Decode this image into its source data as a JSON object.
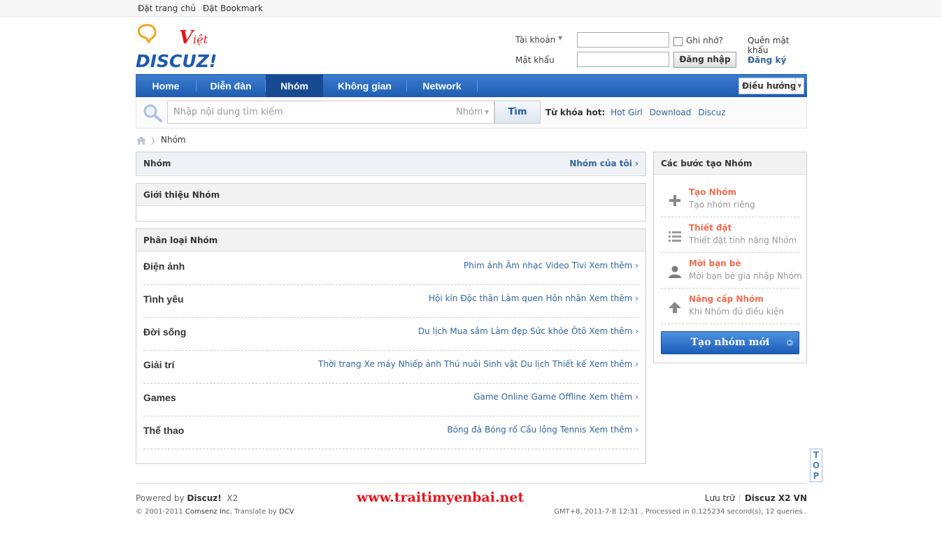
{
  "topbar": {
    "set_home": "Đặt trang chủ",
    "bookmark": "Đặt Bookmark"
  },
  "logo": {
    "script": "Việt",
    "brand": "DISCUZ!"
  },
  "login": {
    "account_label": "Tài khoản",
    "password_label": "Mật khẩu",
    "remember_label": "Ghi nhớ?",
    "forgot_link": "Quên mật khẩu",
    "login_button": "Đăng nhập",
    "register_link": "Đăng ký"
  },
  "nav": {
    "items": [
      "Home",
      "Diễn đàn",
      "Nhóm",
      "Không gian",
      "Network"
    ],
    "active_index": 2,
    "quick_nav": "Điều hướng"
  },
  "search": {
    "placeholder": "Nhập nội dung tìm kiếm",
    "scope": "Nhóm",
    "button": "Tìm",
    "hot_label": "Từ khóa hot:",
    "hot_keywords": [
      "Hot Girl",
      "Download",
      "Discuz"
    ]
  },
  "breadcrumb": {
    "current": "Nhóm"
  },
  "group_header": {
    "title": "Nhóm",
    "my_groups": "Nhóm của tôi ›"
  },
  "intro": {
    "title": "Giới thiệu Nhóm"
  },
  "categories": {
    "title": "Phân loại Nhóm",
    "more_label": "Xem thêm ›",
    "rows": [
      {
        "name": "Điện ảnh",
        "links": [
          "Phim ảnh",
          "Âm nhạc",
          "Video",
          "Tivi"
        ]
      },
      {
        "name": "Tình yêu",
        "links": [
          "Hội kín",
          "Độc thân",
          "Làm quen",
          "Hôn nhân"
        ]
      },
      {
        "name": "Đời sống",
        "links": [
          "Du lịch",
          "Mua sắm",
          "Làm đẹp",
          "Sức khỏe",
          "Ôtô"
        ]
      },
      {
        "name": "Giải trí",
        "links": [
          "Thời trang",
          "Xe máy",
          "Nhiếp ảnh",
          "Thú nuôi",
          "Sinh vật",
          "Du lịch",
          "Thiết kế"
        ]
      },
      {
        "name": "Games",
        "links": [
          "Game Online",
          "Game Offline"
        ]
      },
      {
        "name": "Thể thao",
        "links": [
          "Bóng đá",
          "Bóng rổ",
          "Cầu lông",
          "Tennis"
        ]
      }
    ]
  },
  "sidebar": {
    "title": "Các bước tạo Nhóm",
    "steps": [
      {
        "title": "Tạo Nhóm",
        "desc": "Tạo nhóm riêng",
        "icon": "plus-icon"
      },
      {
        "title": "Thiết đặt",
        "desc": "Thiết đặt tính năng Nhóm",
        "icon": "list-icon"
      },
      {
        "title": "Mời bạn bè",
        "desc": "Mời bạn bè gia nhập Nhóm",
        "icon": "user-icon"
      },
      {
        "title": "Nâng cấp Nhóm",
        "desc": "Khi Nhóm đủ điều kiện",
        "icon": "arrow-up-icon"
      }
    ],
    "create_button": "Tạo nhóm mới"
  },
  "top_button": "TOP",
  "footer": {
    "powered_prefix": "Powered by",
    "powered_brand": "Discuz!",
    "version": "X2",
    "copyright_prefix": "© 2001-2011",
    "company": "Comsenz Inc.",
    "translate_prefix": "Translate by",
    "translator": "DCV",
    "site_url": "www.traitimyenbai.net",
    "archive": "Lưu trữ",
    "edition": "Discuz X2 VN",
    "status": "GMT+8, 2011-7-8 12:31 , Processed in 0.125234 second(s), 12 queries ."
  },
  "colors": {
    "nav_blue": "#1e5caf",
    "link_blue": "#336699",
    "step_orange": "#f26c4f",
    "brand_red": "#e8141a"
  }
}
